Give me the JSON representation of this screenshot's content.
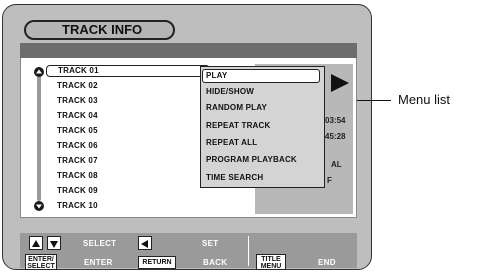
{
  "title": "TRACK INFO",
  "tracks": [
    {
      "label": "TRACK 01"
    },
    {
      "label": "TRACK 02"
    },
    {
      "label": "TRACK 03"
    },
    {
      "label": "TRACK 04"
    },
    {
      "label": "TRACK 05"
    },
    {
      "label": "TRACK 06"
    },
    {
      "label": "TRACK 07"
    },
    {
      "label": "TRACK 08"
    },
    {
      "label": "TRACK 09"
    },
    {
      "label": "TRACK 10"
    }
  ],
  "menu": {
    "items": [
      {
        "label": "PLAY"
      },
      {
        "label": "HIDE/SHOW"
      },
      {
        "label": "RANDOM PLAY"
      },
      {
        "label": "REPEAT TRACK"
      },
      {
        "label": "REPEAT ALL"
      },
      {
        "label": "PROGRAM PLAYBACK"
      },
      {
        "label": "TIME SEARCH"
      }
    ]
  },
  "info": {
    "time1": "03:54",
    "time2": "45:28",
    "mode": "AL",
    "state": "F"
  },
  "callout": "Menu list",
  "footer": {
    "select": "SELECT",
    "set": "SET",
    "enter_key": "ENTER/ SELECT",
    "enter": "ENTER",
    "return_key": "RETURN",
    "back": "BACK",
    "title_key": "TITLE MENU",
    "end": "END"
  }
}
